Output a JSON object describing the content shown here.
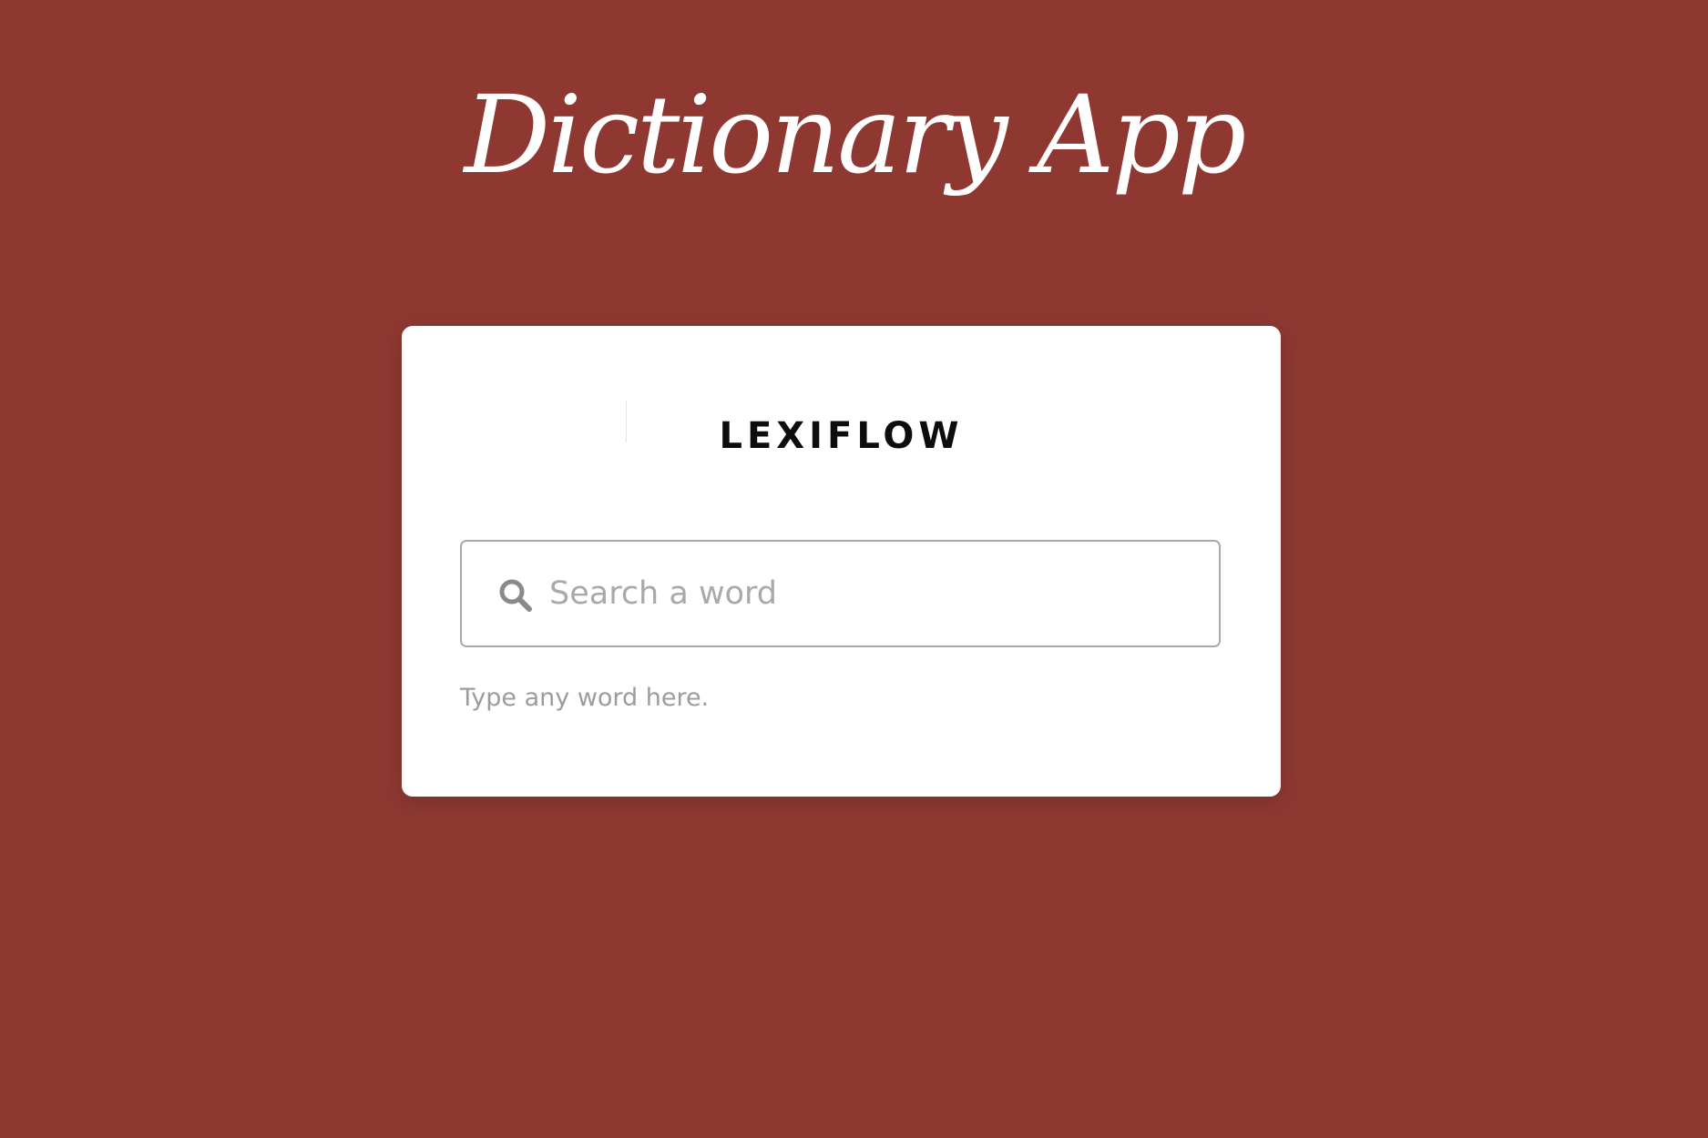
{
  "page": {
    "title": "Dictionary App",
    "background_color": "#8f3832"
  },
  "card": {
    "brand": "LEXIFLOW",
    "search": {
      "placeholder": "Search a word",
      "value": "",
      "icon": "search-icon"
    },
    "hint": "Type any word here."
  }
}
